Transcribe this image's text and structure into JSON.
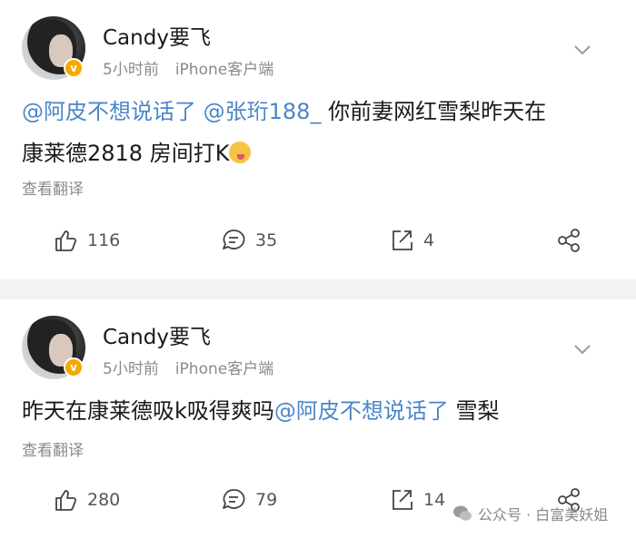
{
  "posts": [
    {
      "username": "Candy要飞",
      "time": "5小时前",
      "source": "iPhone客户端",
      "content": {
        "mention1": "@阿皮不想说话了",
        "mention2": "@张珩188_",
        "text1": "你前妻网红雪梨昨天在",
        "text2": "康莱德2818 房间打K"
      },
      "translate": "查看翻译",
      "actions": {
        "like": "116",
        "comment": "35",
        "repost": "4"
      }
    },
    {
      "username": "Candy要飞",
      "time": "5小时前",
      "source": "iPhone客户端",
      "content": {
        "text1": "昨天在康莱德吸k吸得爽吗",
        "mention1": "@阿皮不想说话了",
        "text2": "雪梨"
      },
      "translate": "查看翻译",
      "actions": {
        "like": "280",
        "comment": "79",
        "repost": "14"
      }
    }
  ],
  "watermark": {
    "text": "公众号 · 白富美妖姐"
  },
  "colors": {
    "mention": "#4a86c8",
    "badge": "#f7a800",
    "divider": "#f2f2f2",
    "meta": "#8a8a8a"
  },
  "icons": [
    "avatar",
    "verified-badge",
    "chevron-down-icon",
    "like-icon",
    "comment-icon",
    "repost-icon",
    "share-icon",
    "wechat-icon"
  ]
}
